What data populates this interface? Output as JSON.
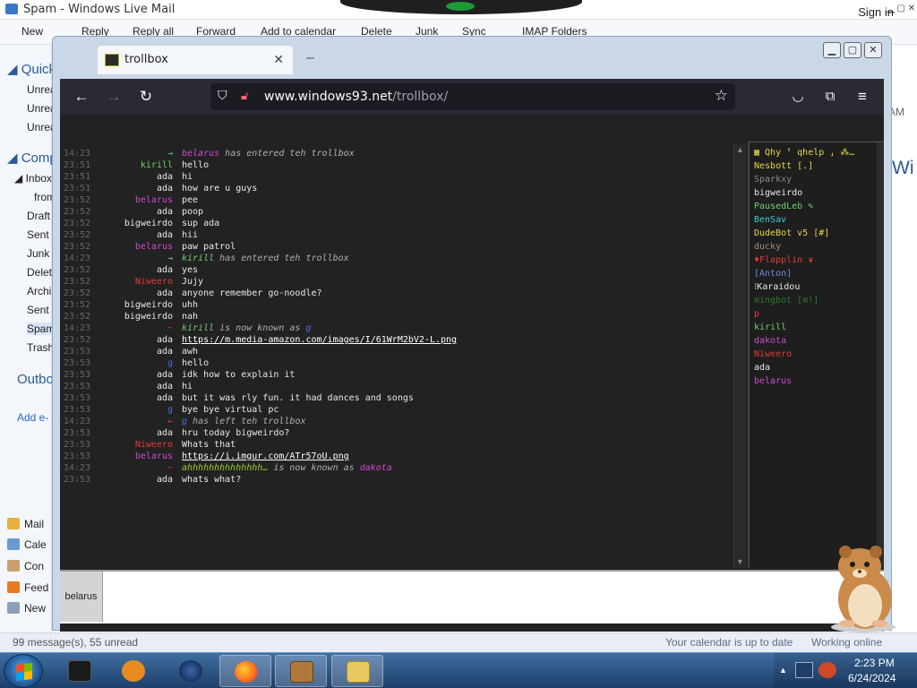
{
  "background_app": {
    "title": "Spam - Windows Live Mail",
    "sign_in": "Sign in",
    "toolbar": [
      "New",
      "Reply",
      "Reply all",
      "Forward",
      "Add to calendar",
      "Delete",
      "Junk",
      "Sync",
      "IMAP Folders"
    ],
    "folders": {
      "quick": "Quick",
      "quick_items": [
        "Unrea",
        "Unrea",
        "Unrea"
      ],
      "compose": "Comp",
      "inbox": "Inbox",
      "from": "from",
      "items": [
        "Draft",
        "Sent",
        "Junk",
        "Delet",
        "Archi",
        "Sent",
        "Spam",
        "Trash"
      ],
      "outbox": "Outbo",
      "add_email": "Add e-"
    },
    "modules": [
      "Mail",
      "Cale",
      "Con",
      "Feed",
      "New"
    ],
    "right_text": [
      "AM",
      "Wi"
    ],
    "status_left": "99 message(s), 55 unread",
    "status_right": "Your calendar is up to date",
    "status_online": "Working online"
  },
  "taskbar": {
    "time": "2:23 PM",
    "date": "6/24/2024"
  },
  "browser": {
    "tab_title": "trollbox",
    "url_domain": "www.windows93.net",
    "url_path": "/trollbox/"
  },
  "trollbox": {
    "messages": [
      {
        "time": "14:23",
        "nick": "→",
        "nick_color": "#6fd06f",
        "text": "belarus",
        "text_color": "#d04ad0",
        "suffix": " has entered teh trollbox",
        "type": "sys"
      },
      {
        "time": "23:51",
        "nick": "kirill",
        "nick_color": "#6fd06f",
        "text": "hello"
      },
      {
        "time": "23:51",
        "nick": "ada",
        "nick_color": "#e8e8e8",
        "text": "hi"
      },
      {
        "time": "23:51",
        "nick": "ada",
        "nick_color": "#e8e8e8",
        "text": "how are u guys"
      },
      {
        "time": "23:52",
        "nick": "belarus",
        "nick_color": "#d04ad0",
        "text": "pee"
      },
      {
        "time": "23:52",
        "nick": "ada",
        "nick_color": "#e8e8e8",
        "text": "poop"
      },
      {
        "time": "23:52",
        "nick": "bigweirdo",
        "nick_color": "#e8e8e8",
        "text": "sup ada"
      },
      {
        "time": "23:52",
        "nick": "ada",
        "nick_color": "#e8e8e8",
        "text": "hii"
      },
      {
        "time": "23:52",
        "nick": "belarus",
        "nick_color": "#d04ad0",
        "text": "paw patrol"
      },
      {
        "time": "14:23",
        "nick": "→",
        "nick_color": "#6fd06f",
        "text": "kirill",
        "text_color": "#6fd06f",
        "suffix": " has entered teh trollbox",
        "type": "sys"
      },
      {
        "time": "23:52",
        "nick": "ada",
        "nick_color": "#e8e8e8",
        "text": "yes"
      },
      {
        "time": "23:52",
        "nick": "Niweero",
        "nick_color": "#e03a3a",
        "text": "Jujy"
      },
      {
        "time": "23:52",
        "nick": "ada",
        "nick_color": "#e8e8e8",
        "text": "anyone remember go-noodle?"
      },
      {
        "time": "23:52",
        "nick": "bigweirdo",
        "nick_color": "#e8e8e8",
        "text": "uhh"
      },
      {
        "time": "23:52",
        "nick": "bigweirdo",
        "nick_color": "#e8e8e8",
        "text": "nah"
      },
      {
        "time": "14:23",
        "nick": "~",
        "nick_color": "#e03a3a",
        "text": "kirill",
        "text_color": "#6fd06f",
        "suffix": " is now known as ",
        "extra": "g",
        "extra_color": "#4a6ee0",
        "type": "sys"
      },
      {
        "time": "23:52",
        "nick": "ada",
        "nick_color": "#e8e8e8",
        "text": "https://m.media-amazon.com/images/I/61WrM2bV2-L.png",
        "type": "link"
      },
      {
        "time": "23:53",
        "nick": "ada",
        "nick_color": "#e8e8e8",
        "text": "awh"
      },
      {
        "time": "23:53",
        "nick": "g",
        "nick_color": "#4a6ee0",
        "text": "hello"
      },
      {
        "time": "23:53",
        "nick": "ada",
        "nick_color": "#e8e8e8",
        "text": "idk how to explain it"
      },
      {
        "time": "23:53",
        "nick": "ada",
        "nick_color": "#e8e8e8",
        "text": "hi"
      },
      {
        "time": "23:53",
        "nick": "ada",
        "nick_color": "#e8e8e8",
        "text": "but it was rly fun. it had dances and songs"
      },
      {
        "time": "23:53",
        "nick": "g",
        "nick_color": "#4a6ee0",
        "text": "bye bye virtual pc"
      },
      {
        "time": "14:23",
        "nick": "←",
        "nick_color": "#e03a3a",
        "text": "g",
        "text_color": "#4a6ee0",
        "suffix": " has left teh trollbox",
        "type": "sys"
      },
      {
        "time": "23:53",
        "nick": "ada",
        "nick_color": "#e8e8e8",
        "text": "hru today bigweirdo?"
      },
      {
        "time": "23:53",
        "nick": "Niweero",
        "nick_color": "#e03a3a",
        "text": "Whats that"
      },
      {
        "time": "23:53",
        "nick": "belarus",
        "nick_color": "#d04ad0",
        "text": "https://i.imgur.com/ATr57oU.png",
        "type": "link"
      },
      {
        "time": "14:23",
        "nick": "~",
        "nick_color": "#e03a3a",
        "text": "ahhhhhhhhhhhhhh…",
        "text_color": "#9acd32",
        "suffix": " is now known as ",
        "extra": "dakota",
        "extra_color": "#d04ad0",
        "type": "sys"
      },
      {
        "time": "23:53",
        "nick": "ada",
        "nick_color": "#e8e8e8",
        "text": "whats what?"
      }
    ],
    "users": [
      {
        "name": "▦ Qhy ⸢ qhelp ⸥ ⁂…",
        "color": "#e8d44a"
      },
      {
        "name": "Nesbott [.]",
        "color": "#e8d44a"
      },
      {
        "name": "Sparkxy",
        "color": "#8a8a8a"
      },
      {
        "name": "bigweirdo",
        "color": "#e8e8e8"
      },
      {
        "name": "PausedLeb ✎",
        "color": "#6fd06f"
      },
      {
        "name": "BenSav",
        "color": "#3ad0d0"
      },
      {
        "name": "DudeBot v5 [#]",
        "color": "#e8d44a"
      },
      {
        "name": "ducky",
        "color": "#b08a6a"
      },
      {
        "name": "♦Flapplin ❦",
        "color": "#e03a3a"
      },
      {
        "name": "[Anton]",
        "color": "#6a8ae0"
      },
      {
        "name": "⁝Karaidou",
        "color": "#e8e8e8"
      },
      {
        "name": "mingbot [m!]",
        "color": "#2a7a2a"
      },
      {
        "name": "p",
        "color": "#e03a3a"
      },
      {
        "name": "kirill",
        "color": "#6fd06f"
      },
      {
        "name": "dakota",
        "color": "#d04ad0"
      },
      {
        "name": "Niweero",
        "color": "#e03a3a"
      },
      {
        "name": "ada",
        "color": "#e8e8e8"
      },
      {
        "name": "belarus",
        "color": "#d04ad0"
      }
    ],
    "nick_label": "belarus"
  }
}
